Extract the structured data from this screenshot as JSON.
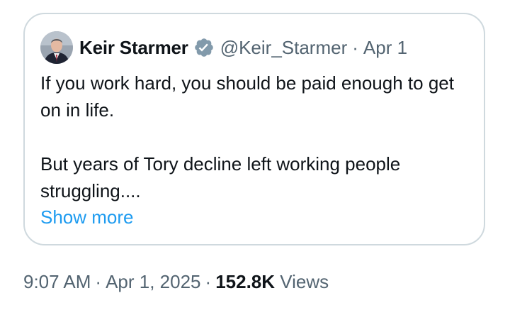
{
  "quoted_tweet": {
    "author_name": "Keir Starmer",
    "handle": "@Keir_Starmer",
    "separator": "·",
    "date": "Apr 1",
    "verified_badge_color": "#829aab",
    "paragraphs": [
      "If you work hard, you should be paid enough to get on in life.",
      "But years of Tory decline left working people struggling...."
    ],
    "show_more_label": "Show more"
  },
  "meta": {
    "time": "9:07 AM",
    "separator": "·",
    "date": "Apr 1, 2025",
    "views_count": "152.8K",
    "views_label": "Views"
  },
  "colors": {
    "text_primary": "#0f1419",
    "text_secondary": "#536471",
    "link": "#1d9bf0",
    "border": "#cfd9de"
  }
}
